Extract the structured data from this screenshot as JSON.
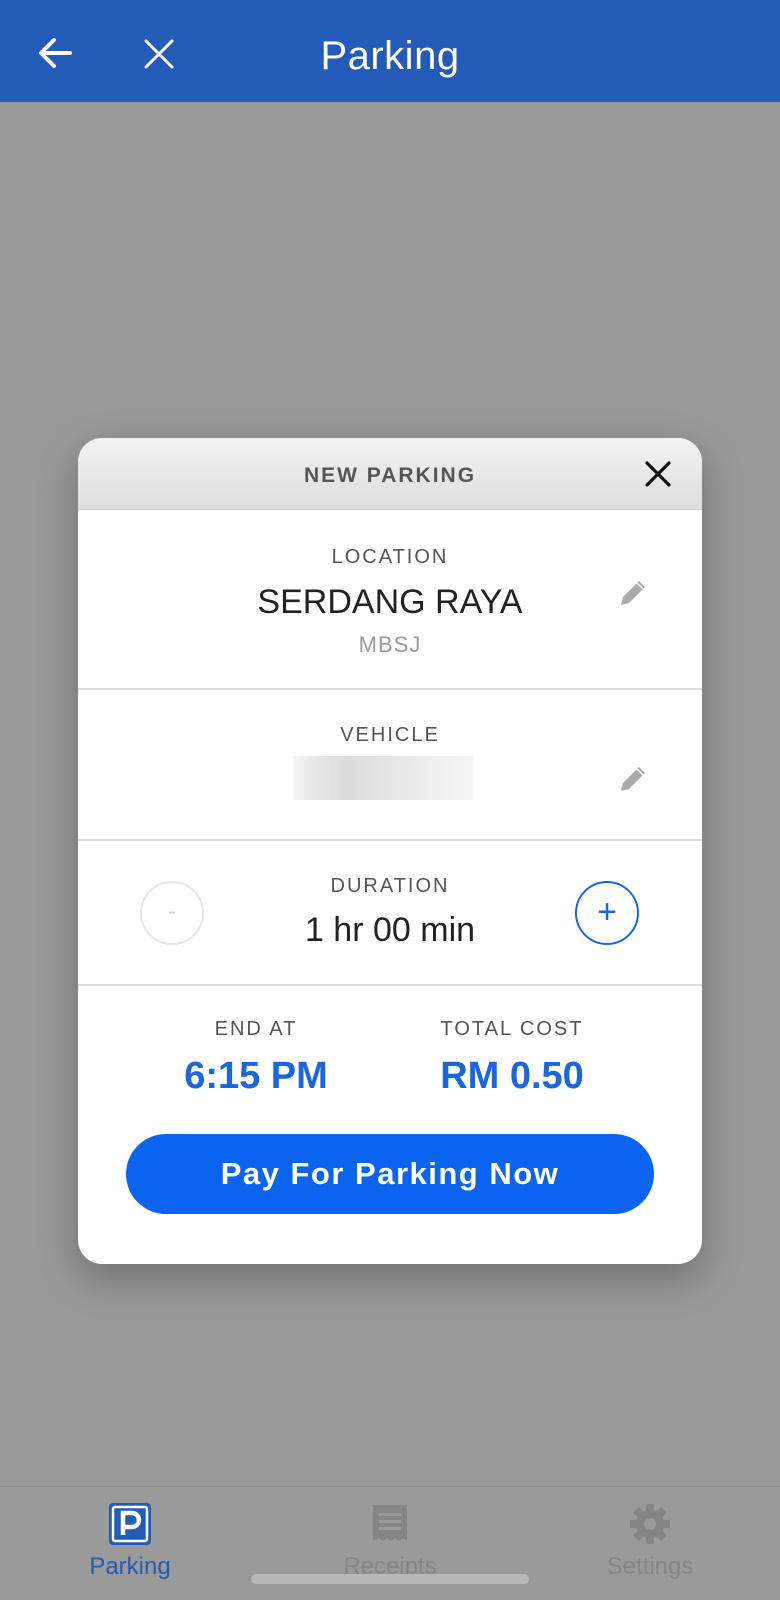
{
  "appbar": {
    "title": "Parking",
    "back_icon": "arrow-left-icon",
    "close_icon": "close-icon",
    "background_color": "#245ab8"
  },
  "modal": {
    "title": "NEW PARKING",
    "close_icon": "close-icon",
    "location": {
      "label": "LOCATION",
      "name": "SERDANG RAYA",
      "authority": "MBSJ",
      "edit_icon": "pencil-icon"
    },
    "vehicle": {
      "label": "VEHICLE",
      "plate_redacted": true,
      "edit_icon": "pencil-icon"
    },
    "duration": {
      "label": "DURATION",
      "value": "1 hr 00 min",
      "decrease_label": "-",
      "increase_label": "+",
      "decrease_enabled": false
    },
    "summary": {
      "end_label": "END AT",
      "end_value": "6:15 PM",
      "cost_label": "TOTAL COST",
      "cost_value": "RM 0.50"
    },
    "pay_button": "Pay For Parking Now",
    "accent_color": "#1a66e0"
  },
  "tabbar": {
    "tabs": [
      {
        "label": "Parking",
        "icon": "parking-icon",
        "active": true
      },
      {
        "label": "Receipts",
        "icon": "receipt-icon",
        "active": false
      },
      {
        "label": "Settings",
        "icon": "gear-icon",
        "active": false
      }
    ]
  }
}
